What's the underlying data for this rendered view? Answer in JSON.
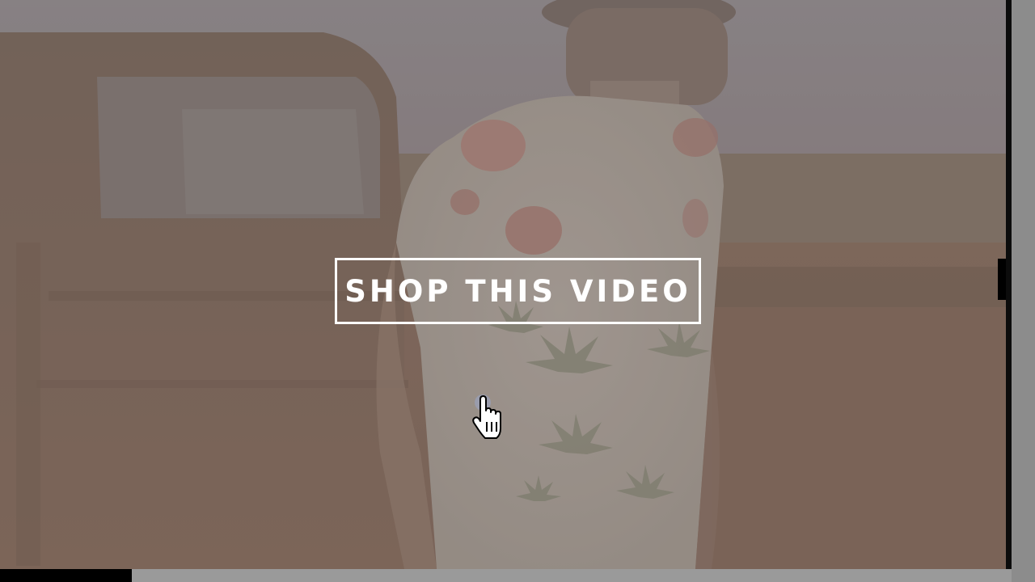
{
  "video": {
    "cta_label": "SHOP THIS VIDEO",
    "progress": 0.13
  },
  "colors": {
    "cta_border": "#ffffff",
    "cta_text": "#ffffff",
    "progress_fill": "#000000",
    "progress_track": "#9a9a9a"
  },
  "icons": {
    "cursor": "hand-pointer-icon"
  }
}
